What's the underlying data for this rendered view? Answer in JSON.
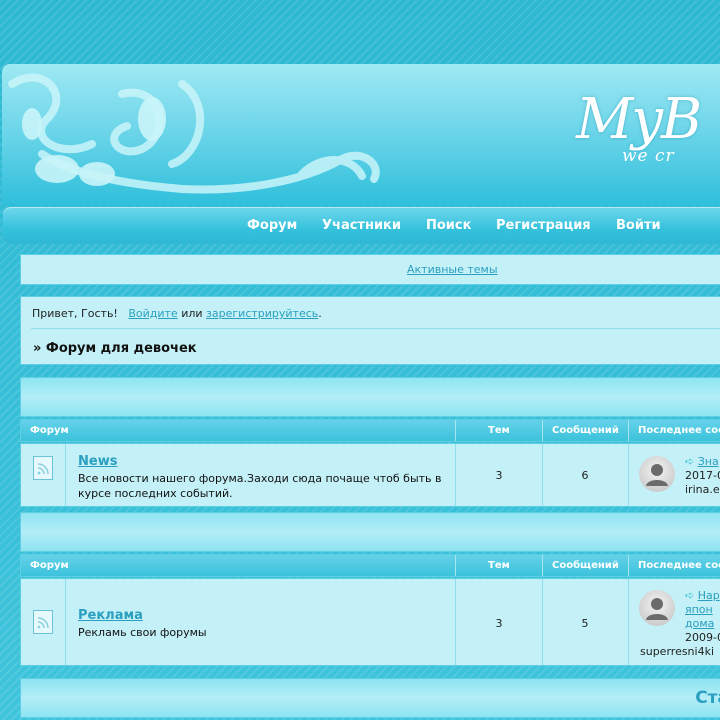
{
  "header": {
    "logo_text": "MyB",
    "tagline": "we cr"
  },
  "nav": {
    "items": [
      "Форум",
      "Участники",
      "Поиск",
      "Регистрация",
      "Войти"
    ]
  },
  "active_topics_link": "Активные темы",
  "welcome": {
    "greeting": "Привет, Гость!",
    "login_link": "Войдите",
    "or_text": "или",
    "register_link": "зарегистрируйтесь",
    "period": ".",
    "board_title": "» Форум для девочек"
  },
  "table_headers": {
    "forum": "Форум",
    "topics": "Тем",
    "posts": "Сообщений",
    "last_post": "Последнее сообщ"
  },
  "forums": [
    {
      "name": "News",
      "description": "Все новости нашего форума.Заходи сюда почаще чтоб быть в курсе последних событий.",
      "topics": "3",
      "posts": "6",
      "last_post_title": "Зна",
      "last_post_date": "2017-0",
      "last_post_user": "irina.e"
    },
    {
      "name": "Реклама",
      "description": "Рекламь свои форумы",
      "topics": "3",
      "posts": "5",
      "last_post_title_lines": [
        "Нар",
        "япон",
        "дома"
      ],
      "last_post_date": "2009-0",
      "last_post_user": "superresni4ki"
    }
  ],
  "stats_heading": "Ста",
  "colors": {
    "accent": "#2a9fc0",
    "background": "#3ec4dc",
    "panel": "#c4f1f7"
  }
}
